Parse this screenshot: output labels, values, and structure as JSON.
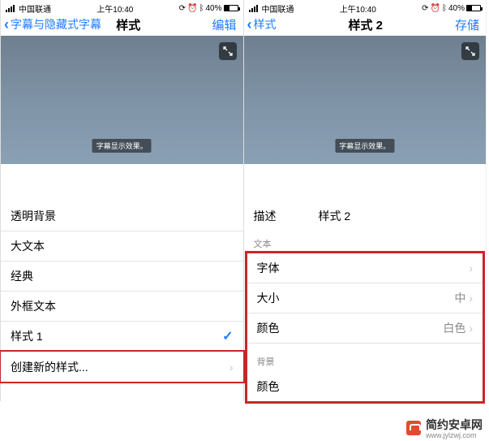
{
  "status": {
    "carrier": "中国联通",
    "time": "上午10:40",
    "battery_pct": "40%"
  },
  "left": {
    "nav": {
      "back": "字幕与隐藏式字幕",
      "title": "样式",
      "action": "编辑"
    },
    "preview_sample": "字幕显示效果。",
    "rows": [
      {
        "label": "透明背景"
      },
      {
        "label": "大文本"
      },
      {
        "label": "经典"
      },
      {
        "label": "外框文本"
      },
      {
        "label": "样式 1",
        "checked": true
      },
      {
        "label": "创建新的样式...",
        "disclosure": true
      }
    ]
  },
  "right": {
    "nav": {
      "back": "样式",
      "title": "样式 2",
      "action": "存储"
    },
    "preview_sample": "字幕显示效果。",
    "description": {
      "label": "描述",
      "value": "样式 2"
    },
    "section_text": "文本",
    "text_rows": [
      {
        "label": "字体",
        "value": "",
        "disclosure": true
      },
      {
        "label": "大小",
        "value": "中",
        "disclosure": true
      },
      {
        "label": "颜色",
        "value": "白色",
        "disclosure": true
      }
    ],
    "section_bg": "背景",
    "bg_rows": [
      {
        "label": "颜色",
        "value": "",
        "disclosure": false
      }
    ]
  },
  "watermark": {
    "name": "简约安卓网",
    "url": "www.jylzwj.com"
  }
}
